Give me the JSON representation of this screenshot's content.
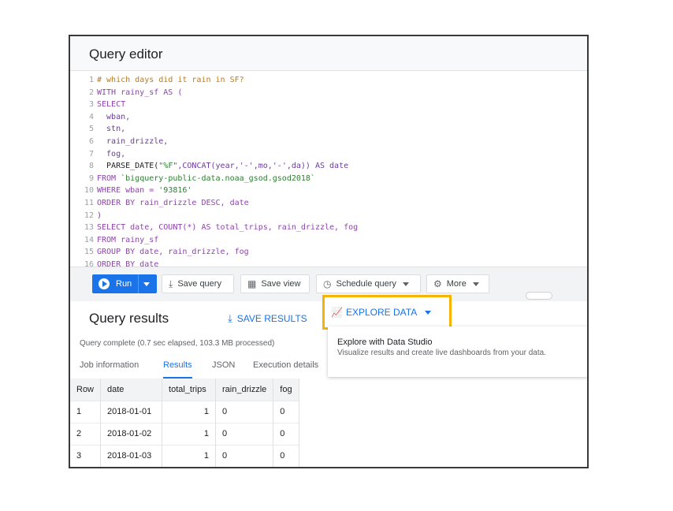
{
  "editor": {
    "title": "Query editor",
    "lines": [
      {
        "n": "1",
        "tokens": [
          {
            "t": "# which days did it rain in SF?",
            "c": "tok-cm"
          }
        ]
      },
      {
        "n": "2",
        "tokens": [
          {
            "t": "WITH rainy_sf AS (",
            "c": "tok-kw"
          }
        ]
      },
      {
        "n": "3",
        "tokens": [
          {
            "t": "SELECT",
            "c": "tok-kw"
          }
        ]
      },
      {
        "n": "4",
        "tokens": [
          {
            "t": "  wban,",
            "c": "tok-plain"
          }
        ]
      },
      {
        "n": "5",
        "tokens": [
          {
            "t": "  stn,",
            "c": "tok-plain"
          }
        ]
      },
      {
        "n": "6",
        "tokens": [
          {
            "t": "  rain_drizzle,",
            "c": "tok-plain"
          }
        ]
      },
      {
        "n": "7",
        "tokens": [
          {
            "t": "  fog,",
            "c": "tok-plain"
          }
        ]
      },
      {
        "n": "8",
        "tokens": [
          {
            "t": "  PARSE_DATE(",
            "c": "tok-fn"
          },
          {
            "t": "\"%F\"",
            "c": "tok-str"
          },
          {
            "t": ",CONCAT(year,'-',mo,'-',da)) AS date",
            "c": "tok-plain"
          }
        ]
      },
      {
        "n": "9",
        "tokens": [
          {
            "t": "FROM ",
            "c": "tok-kw"
          },
          {
            "t": "`bigquery-public-data.noaa_gsod.gsod2018`",
            "c": "tok-str"
          }
        ]
      },
      {
        "n": "10",
        "tokens": [
          {
            "t": "WHERE wban = ",
            "c": "tok-kw"
          },
          {
            "t": "'93816'",
            "c": "tok-str"
          }
        ]
      },
      {
        "n": "11",
        "tokens": [
          {
            "t": "ORDER BY rain_drizzle DESC, date",
            "c": "tok-kw"
          }
        ]
      },
      {
        "n": "12",
        "tokens": [
          {
            "t": ")",
            "c": "tok-plain"
          }
        ]
      },
      {
        "n": "13",
        "tokens": [
          {
            "t": "SELECT date, COUNT(*) AS total_trips, rain_drizzle, fog",
            "c": "tok-kw"
          }
        ]
      },
      {
        "n": "14",
        "tokens": [
          {
            "t": "FROM rainy_sf",
            "c": "tok-kw"
          }
        ]
      },
      {
        "n": "15",
        "tokens": [
          {
            "t": "GROUP BY date, rain_drizzle, fog",
            "c": "tok-kw"
          }
        ]
      },
      {
        "n": "16",
        "tokens": [
          {
            "t": "ORDER BY date",
            "c": "tok-kw"
          }
        ]
      }
    ]
  },
  "toolbar": {
    "run": "Run",
    "save_query": "Save query",
    "save_view": "Save view",
    "schedule_query": "Schedule query",
    "more": "More"
  },
  "results": {
    "title": "Query results",
    "save_results": "SAVE RESULTS",
    "explore_data": "EXPLORE DATA",
    "status": "Query complete (0.7 sec elapsed, 103.3 MB processed)",
    "tabs": [
      "Job information",
      "Results",
      "JSON",
      "Execution details"
    ],
    "active_tab": "Results",
    "columns": [
      "Row",
      "date",
      "total_trips",
      "rain_drizzle",
      "fog"
    ],
    "rows": [
      [
        "1",
        "2018-01-01",
        "1",
        "0",
        "0"
      ],
      [
        "2",
        "2018-01-02",
        "1",
        "0",
        "0"
      ],
      [
        "3",
        "2018-01-03",
        "1",
        "0",
        "0"
      ]
    ]
  },
  "dropdown": {
    "title": "Explore with Data Studio",
    "subtitle": "Visualize results and create live dashboards from your data."
  },
  "colors": {
    "accent": "#1a73e8",
    "highlight": "#f4b400"
  }
}
